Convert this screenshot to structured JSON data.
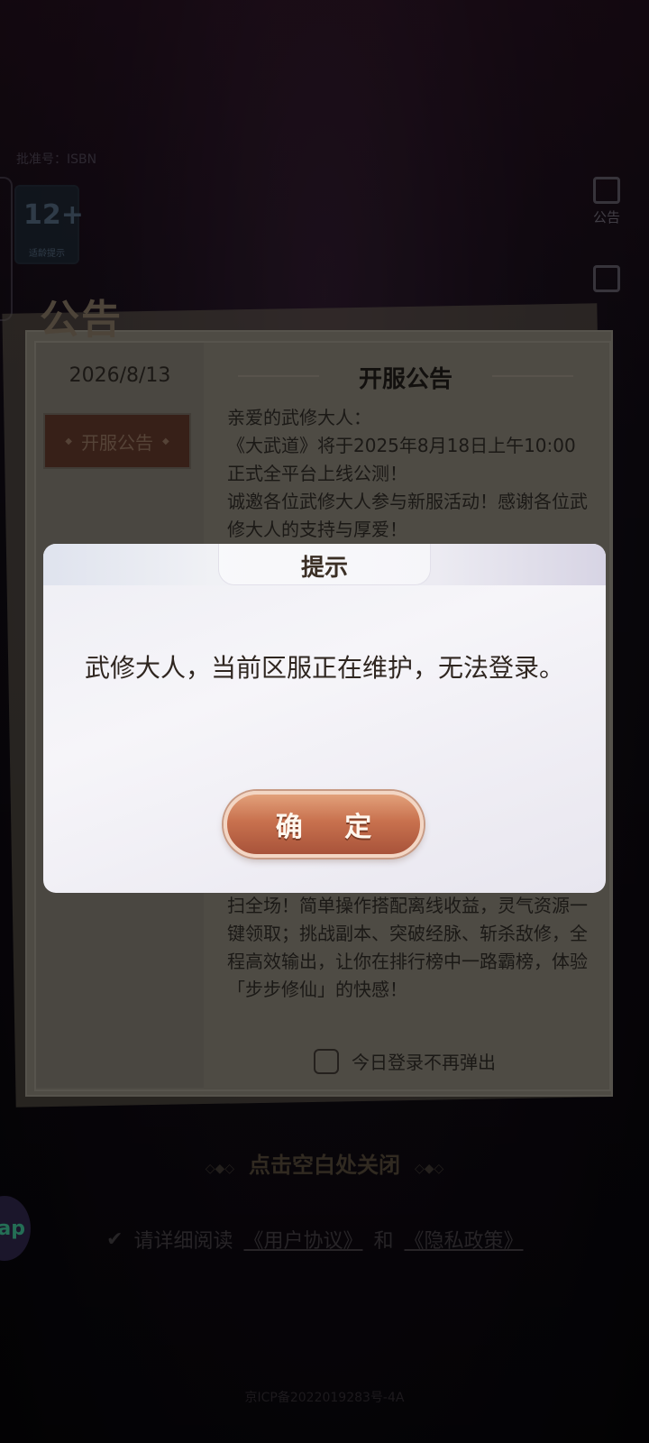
{
  "background": {
    "isbn_text": "批准号：ISBN"
  },
  "age_badge": {
    "number": "12+",
    "label": "适龄提示"
  },
  "side_buttons": {
    "notice_label": "公告"
  },
  "panel": {
    "title": "公告",
    "date": "2026/8/13",
    "tab_label": "开服公告",
    "announcement_title": "开服公告",
    "body_top": [
      "亲爱的武修大人：",
      "《大武道》将于2025年8月18日上午10:00正式全平台上线公测！",
      "诚邀各位武修大人参与新服活动！感谢各位武修大人的支持与厚爱！"
    ],
    "body_bottom": "单手挂机也能狂飙战力！每天挂个机，照样横扫全场！简单操作搭配离线收益，灵气资源一键领取；挑战副本、突破经脉、斩杀敌修，全程高效输出，让你在排行榜中一路霸榜，体验「步步修仙」的快感！",
    "checkbox_label": "今日登录不再弹出"
  },
  "close_hint": "点击空白处关闭",
  "tap_button": "ap",
  "agreement": {
    "prefix": "请详细阅读",
    "user_agreement": "《用户协议》",
    "and": "和",
    "privacy_policy": "《隐私政策》"
  },
  "footer": {
    "icp": "京ICP备2022019283号-4A"
  },
  "modal": {
    "title": "提示",
    "message": "武修大人，当前区服正在维护，无法登录。",
    "confirm_label": "确 定"
  }
}
